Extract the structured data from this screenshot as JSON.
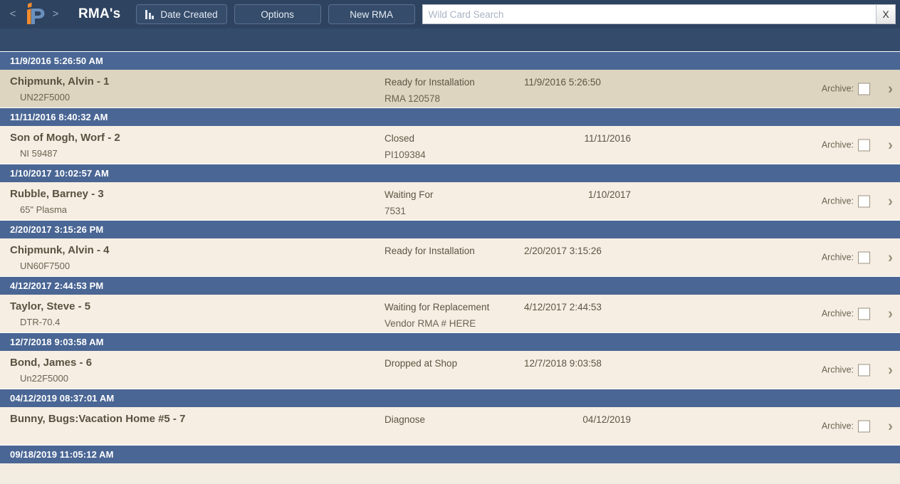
{
  "toolbar": {
    "nav_back": "<",
    "nav_forward": ">",
    "logo_name": "ip-logo",
    "title": "RMA's",
    "sort_button": "Date Created",
    "options_button": "Options",
    "new_button": "New RMA",
    "search_placeholder": "Wild Card Search",
    "search_value": "",
    "search_clear": "X"
  },
  "colors": {
    "toolbar_bg": "#2e4360",
    "subbar_bg": "#344b6b",
    "group_header_bg": "#4a6694",
    "row_bg": "#f6eee2",
    "row_selected_bg": "#ddd5bf",
    "accent_orange": "#f29239",
    "logo_blue": "#6a90bd",
    "text_brown": "#5d5443"
  },
  "list": {
    "archive_label": "Archive:",
    "chevron_glyph": "›",
    "groups": [
      {
        "header": "11/9/2016 5:26:50 AM",
        "rows": [
          {
            "name": "Chipmunk, Alvin - 1",
            "sub": "UN22F5000",
            "status": "Ready for Installation",
            "status2": "RMA 120578",
            "date": "11/9/2016 5:26:50",
            "date_align": "left",
            "archive_checked": false,
            "selected": true
          }
        ]
      },
      {
        "header": "11/11/2016 8:40:32 AM",
        "rows": [
          {
            "name": "Son of Mogh, Worf - 2",
            "sub": "NI 59487",
            "status": "Closed",
            "status2": "PI109384",
            "date": "11/11/2016",
            "date_align": "right",
            "archive_checked": false,
            "selected": false
          }
        ]
      },
      {
        "header": "1/10/2017 10:02:57 AM",
        "rows": [
          {
            "name": "Rubble, Barney - 3",
            "sub": "65\" Plasma",
            "status": "Waiting For",
            "status2": "7531",
            "date": "1/10/2017",
            "date_align": "right",
            "archive_checked": false,
            "selected": false
          }
        ]
      },
      {
        "header": "2/20/2017 3:15:26 PM",
        "rows": [
          {
            "name": "Chipmunk, Alvin - 4",
            "sub": "UN60F7500",
            "status": "Ready for Installation",
            "status2": "",
            "date": "2/20/2017 3:15:26",
            "date_align": "left",
            "archive_checked": false,
            "selected": false
          }
        ]
      },
      {
        "header": "4/12/2017 2:44:53 PM",
        "rows": [
          {
            "name": "Taylor, Steve - 5",
            "sub": "DTR-70.4",
            "status": "Waiting for Replacement",
            "status2": "Vendor RMA # HERE",
            "date": "4/12/2017 2:44:53",
            "date_align": "left",
            "archive_checked": false,
            "selected": false
          }
        ]
      },
      {
        "header": "12/7/2018 9:03:58 AM",
        "rows": [
          {
            "name": "Bond, James - 6",
            "sub": "Un22F5000",
            "status": "Dropped at Shop",
            "status2": "",
            "date": "12/7/2018 9:03:58",
            "date_align": "left",
            "archive_checked": false,
            "selected": false
          }
        ]
      },
      {
        "header": "04/12/2019 08:37:01 AM",
        "rows": [
          {
            "name": "Bunny, Bugs:Vacation Home #5 - 7",
            "sub": "",
            "status": "Diagnose",
            "status2": "",
            "date": "04/12/2019",
            "date_align": "right",
            "archive_checked": false,
            "selected": false
          }
        ]
      },
      {
        "header": "09/18/2019 11:05:12 AM",
        "rows": []
      }
    ]
  }
}
